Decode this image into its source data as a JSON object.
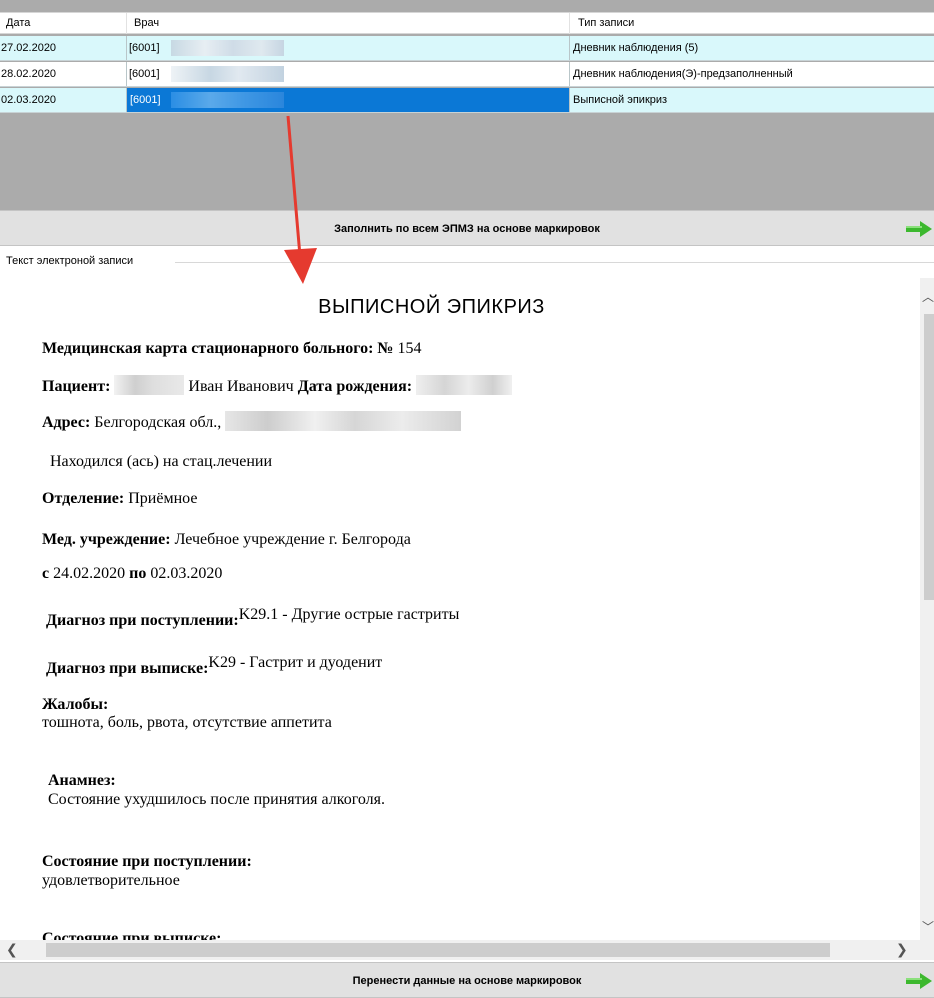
{
  "grid": {
    "columns": [
      "Дата",
      "Врач",
      "Тип записи"
    ],
    "rows": [
      {
        "date": "27.02.2020",
        "doctor": "[6001]",
        "type": "Дневник наблюдения (5)"
      },
      {
        "date": "28.02.2020",
        "doctor": "[6001]",
        "type": "Дневник наблюдения(Э)-предзаполненный"
      },
      {
        "date": "02.03.2020",
        "doctor": "[6001]",
        "type": "Выписной эпикриз"
      }
    ],
    "selected_row": 2,
    "row_colors": {
      "alt": "#d9f8fb",
      "selected": "#0b78d6"
    }
  },
  "buttons": {
    "fill_all": "Заполнить по всем ЭПМЗ на основе маркировок",
    "transfer": "Перенести данные на основе маркировок"
  },
  "group_label": "Текст электроной записи",
  "document": {
    "title": "ВЫПИСНОЙ ЭПИКРИЗ",
    "card_label": "Медицинская карта стационарного больного: №",
    "card_number": "154",
    "patient_label": "Пациент:",
    "patient_name": "Иван Иванович",
    "birth_label": "Дата рождения:",
    "address_label": "Адрес:",
    "address_value": "Белгородская обл., ",
    "stay_text": "Находился (ась) на стац.лечении",
    "department_label": "Отделение:",
    "department_value": "Приёмное",
    "institution_label": "Мед. учреждение:",
    "institution_value": "Лечебное учреждение г. Белгорода",
    "from_label": "с",
    "from_date": "24.02.2020",
    "to_label": "по",
    "to_date": "02.03.2020",
    "admit_dx_label": "Диагноз при поступлении:",
    "admit_dx_value": "K29.1 - Другие острые гастриты",
    "discharge_dx_label": "Диагноз при выписке:",
    "discharge_dx_value": "K29 - Гастрит и дуоденит",
    "complaints_label": "Жалобы:",
    "complaints_value": "тошнота, боль, рвота, отсутствие аппетита",
    "anamnesis_label": "Анамнез:",
    "anamnesis_value": "Состояние ухудшилось после принятия алкоголя.",
    "admit_state_label": "Состояние при поступлении:",
    "admit_state_value": "удовлетворительное",
    "discharge_state_label": "Состояние при выписке:"
  },
  "icons": {
    "green_arrow": "arrow-right-icon",
    "annotation": "red-arrow-annotation"
  },
  "colors": {
    "annotation": "#e53a2f",
    "green_arrow": "#3cb82e"
  }
}
